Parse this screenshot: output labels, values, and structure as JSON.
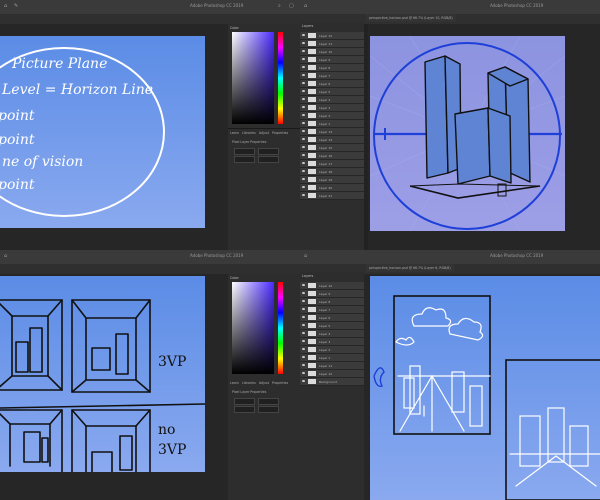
{
  "app": {
    "title": "Adobe Photoshop CC 2019"
  },
  "q1": {
    "whiteboard_lines": [
      "Picture Plane",
      "Level = Horizon Line",
      "point",
      "point",
      "ne of vision",
      "point"
    ],
    "panels": {
      "color": "Color",
      "layers": "Layers",
      "properties": "Properties"
    },
    "prop_tabs": [
      "Learn",
      "Libraries",
      "Adjust",
      "Properties"
    ],
    "prop_label": "Pixel Layer Properties"
  },
  "q2": {
    "doc_tab": "perspective_horizon.psd @ 66.7% (Layer 10, RGB/8)",
    "layers_title": "Layers",
    "layers": [
      "Layer 12",
      "Layer 11",
      "Layer 10",
      "Layer 9",
      "Layer 8",
      "Layer 7",
      "Layer 6",
      "Layer 5",
      "Layer 4",
      "Layer 3",
      "Layer 2",
      "Layer 1",
      "Layer 13",
      "Layer 14",
      "Layer 15",
      "Layer 16",
      "Layer 17",
      "Layer 18",
      "Layer 19",
      "Layer 20",
      "Layer 21"
    ]
  },
  "q3": {
    "labels": [
      "3VP",
      "no",
      "3VP"
    ],
    "panels": {
      "color": "Color",
      "layers": "Layers",
      "properties": "Properties"
    },
    "prop_tabs": [
      "Learn",
      "Libraries",
      "Adjust",
      "Properties"
    ],
    "prop_label": "Pixel Layer Properties"
  },
  "q4": {
    "doc_tab": "perspective_horizon.psd @ 66.7% (Layer 6, RGB/8)",
    "layers_title": "Layers",
    "layers": [
      "Layer 10",
      "Layer 9",
      "Layer 8",
      "Layer 7",
      "Layer 6",
      "Layer 5",
      "Layer 4",
      "Layer 3",
      "Layer 2",
      "Layer 1",
      "Layer 11",
      "Layer 12",
      "Background"
    ]
  },
  "colors": {
    "canvas_top": "#5b8ce6",
    "canvas_bottom": "#8aa9ef",
    "ui_dark": "#262626",
    "accent_blue": "#1e3fd8"
  }
}
